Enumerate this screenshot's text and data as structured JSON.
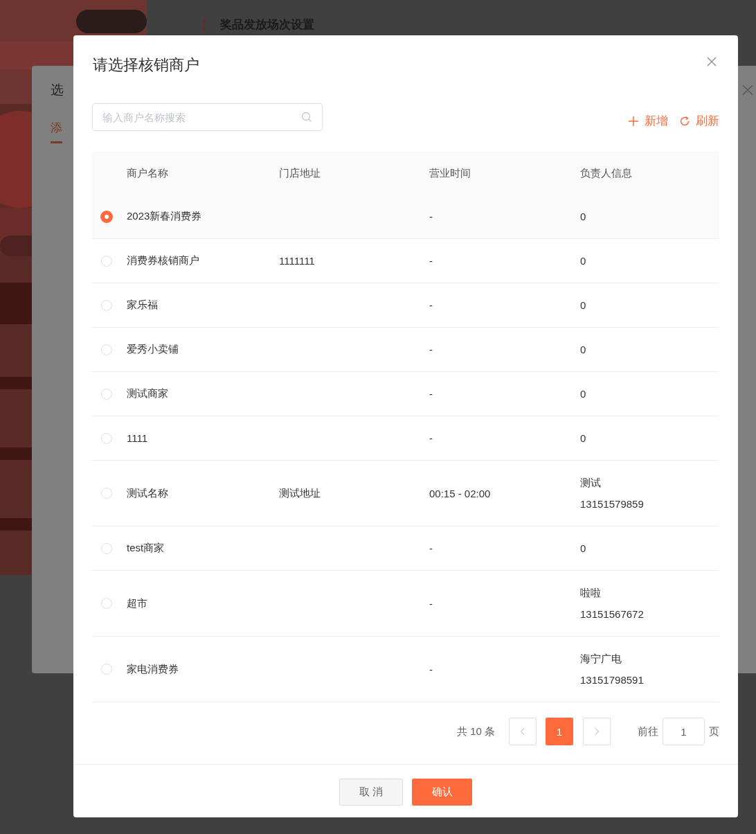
{
  "background_page": {
    "section_title": "奖品发放场次设置"
  },
  "back_dialog": {
    "title": "选",
    "tab": "添"
  },
  "dialog": {
    "title": "请选择核销商户",
    "search": {
      "placeholder": "输入商户名称搜索"
    },
    "actions": [
      {
        "kind": "add",
        "label": "新增"
      },
      {
        "kind": "refresh",
        "label": "刷新"
      }
    ],
    "table": {
      "columns": [
        "商户名称",
        "门店地址",
        "营业时间",
        "负责人信息"
      ],
      "rows": [
        {
          "selected": true,
          "name": "2023新春消费券",
          "address": "",
          "hours": "-",
          "contact": [
            "0"
          ]
        },
        {
          "selected": false,
          "name": "消费券核销商户",
          "address": "1111111",
          "hours": "-",
          "contact": [
            "0"
          ]
        },
        {
          "selected": false,
          "name": "家乐福",
          "address": "",
          "hours": "-",
          "contact": [
            "0"
          ]
        },
        {
          "selected": false,
          "name": "爱秀小卖铺",
          "address": "",
          "hours": "-",
          "contact": [
            "0"
          ]
        },
        {
          "selected": false,
          "name": "测试商家",
          "address": "",
          "hours": "-",
          "contact": [
            "0"
          ]
        },
        {
          "selected": false,
          "name": "1111",
          "address": "",
          "hours": "-",
          "contact": [
            "0"
          ]
        },
        {
          "selected": false,
          "name": "测试名称",
          "address": "测试地址",
          "hours": "00:15 - 02:00",
          "contact": [
            "测试",
            "13151579859"
          ]
        },
        {
          "selected": false,
          "name": "test商家",
          "address": "",
          "hours": "-",
          "contact": [
            "0"
          ]
        },
        {
          "selected": false,
          "name": "超市",
          "address": "",
          "hours": "-",
          "contact": [
            "啦啦",
            "13151567672"
          ]
        },
        {
          "selected": false,
          "name": "家电消费券",
          "address": "",
          "hours": "-",
          "contact": [
            "海宁广电",
            "13151798591"
          ]
        }
      ]
    },
    "pagination": {
      "total": "共 10 条",
      "pages": [
        {
          "label": "1",
          "selected": true
        }
      ],
      "goto_label": "前往",
      "goto_value": "1",
      "goto_suffix": "页"
    },
    "buttons": [
      {
        "kind": "cancel",
        "label": "取 消"
      },
      {
        "kind": "confirm",
        "label": "确认"
      }
    ]
  }
}
